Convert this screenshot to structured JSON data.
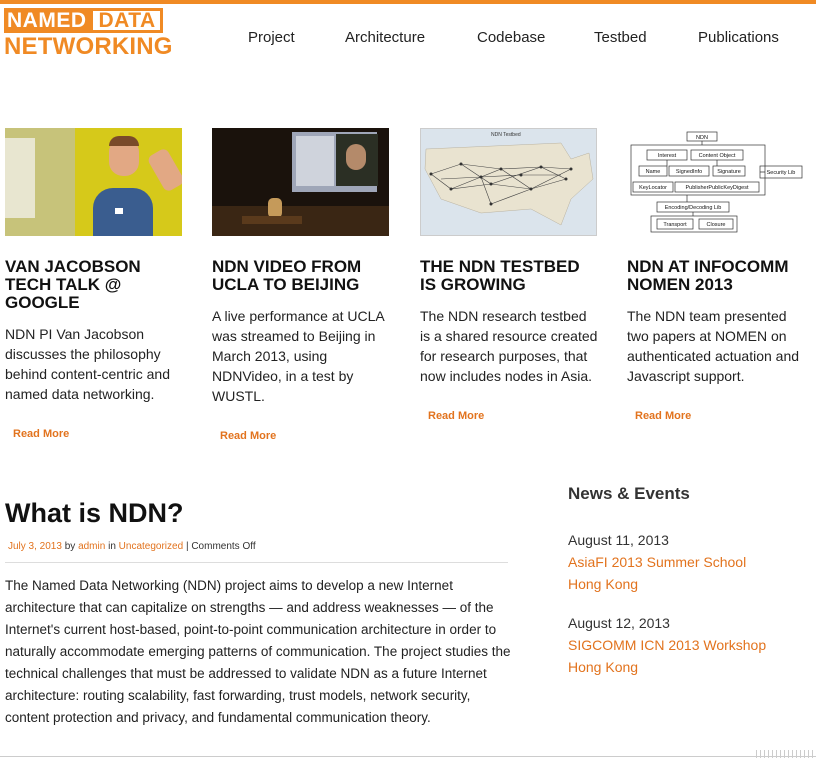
{
  "logo": {
    "line1_a": "NAMED",
    "line1_b": "DATA",
    "line2": "NETWORKING"
  },
  "nav": [
    "Project",
    "Architecture",
    "Codebase",
    "Testbed",
    "Publications"
  ],
  "cards": [
    {
      "title": "VAN JACOBSON TECH TALK @ GOOGLE",
      "body": "NDN PI Van Jacobson discusses the philosophy behind content-centric and named data networking.",
      "more": "Read More"
    },
    {
      "title": "NDN VIDEO FROM UCLA TO BEIJING",
      "body": "A live performance at UCLA was streamed to Beijing in March 2013, using NDNVideo, in a test by WUSTL.",
      "more": "Read More"
    },
    {
      "title": "THE NDN TESTBED IS GROWING",
      "body": "The NDN research testbed is a shared resource created for research purposes, that now includes nodes in Asia.",
      "more": "Read More",
      "thumb_label": "NDN Testbed"
    },
    {
      "title": "NDN AT INFOCOMM NOMEN 2013",
      "body": "The NDN team presented two papers at NOMEN on authenticated actuation and Javascript support.",
      "more": "Read More",
      "diagram": {
        "top": "NDN",
        "interest": "Interest",
        "content": "Content Object",
        "name": "Name",
        "signed": "SignedInfo",
        "signature": "Signature",
        "security": "Security Lib",
        "keylocator": "KeyLocator",
        "digest": "PublisherPublicKeyDigest",
        "encoding": "Encoding/Decoding Lib",
        "transport": "Transport",
        "closure": "Closure"
      }
    }
  ],
  "post": {
    "title": "What is NDN?",
    "date": "July 3, 2013",
    "by": "by",
    "author": "admin",
    "in": "in",
    "category": "Uncategorized",
    "sep": "|",
    "comments": "Comments Off",
    "body": "The Named Data Networking (NDN) project aims to develop a new Internet architecture that can capitalize on strengths — and address weaknesses — of the Internet's current host-based, point-to-point communication architecture in order to naturally accommodate emerging patterns of communication. The project studies the technical challenges that must be addressed to validate NDN as a future Internet architecture: routing scalability, fast forwarding, trust models, network security, content protection and privacy, and fundamental communication theory."
  },
  "news": {
    "title": "News & Events",
    "events": [
      {
        "date": "August 11, 2013",
        "name": "AsiaFI 2013 Summer School",
        "location": "Hong Kong"
      },
      {
        "date": "August 12, 2013",
        "name": "SIGCOMM ICN 2013 Workshop",
        "location": "Hong Kong"
      }
    ]
  },
  "colors": {
    "accent": "#f08a24",
    "link": "#e2731e"
  }
}
